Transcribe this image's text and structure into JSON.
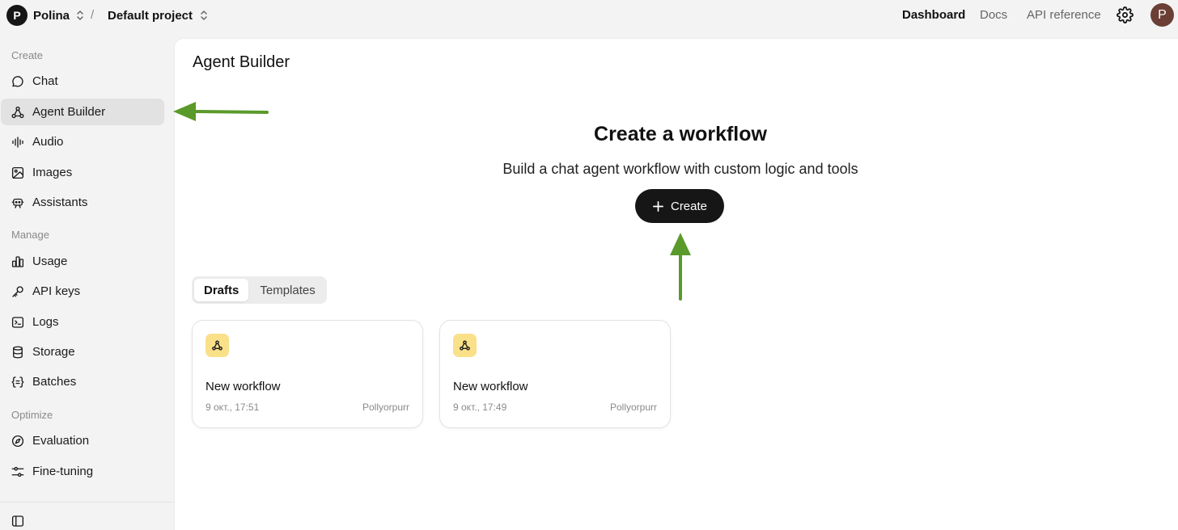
{
  "topbar": {
    "org_initial": "P",
    "org_name": "Polina",
    "separator": "/",
    "project_name": "Default project",
    "nav": {
      "dashboard": "Dashboard",
      "docs": "Docs",
      "api_reference": "API reference"
    },
    "user_initial": "P"
  },
  "sidebar": {
    "sections": [
      {
        "label": "Create",
        "items": [
          {
            "label": "Chat",
            "icon": "chat-bubble-icon"
          },
          {
            "label": "Agent Builder",
            "icon": "agent-builder-icon",
            "active": true
          },
          {
            "label": "Audio",
            "icon": "audio-wave-icon"
          },
          {
            "label": "Images",
            "icon": "image-icon"
          },
          {
            "label": "Assistants",
            "icon": "robot-icon"
          }
        ]
      },
      {
        "label": "Manage",
        "items": [
          {
            "label": "Usage",
            "icon": "bar-chart-icon"
          },
          {
            "label": "API keys",
            "icon": "key-icon"
          },
          {
            "label": "Logs",
            "icon": "terminal-icon"
          },
          {
            "label": "Storage",
            "icon": "database-icon"
          },
          {
            "label": "Batches",
            "icon": "braces-icon"
          }
        ]
      },
      {
        "label": "Optimize",
        "items": [
          {
            "label": "Evaluation",
            "icon": "compass-icon"
          },
          {
            "label": "Fine-tuning",
            "icon": "sliders-icon"
          }
        ]
      }
    ]
  },
  "main": {
    "page_title": "Agent Builder",
    "hero": {
      "title": "Create a workflow",
      "subtitle": "Build a chat agent workflow with custom logic and tools",
      "create_label": "Create"
    },
    "tabs": [
      {
        "label": "Drafts",
        "active": true
      },
      {
        "label": "Templates",
        "active": false
      }
    ],
    "cards": [
      {
        "title": "New workflow",
        "date": "9 окт., 17:51",
        "owner": "Pollyorpurr"
      },
      {
        "title": "New workflow",
        "date": "9 окт., 17:49",
        "owner": "Pollyorpurr"
      }
    ]
  },
  "colors": {
    "background": "#f3f3f3",
    "main_background": "#ffffff",
    "primary_button": "#161616",
    "card_icon_bg": "#fbe08a",
    "annotation_arrow": "#5a9a2b",
    "user_avatar": "#6b3f35"
  }
}
